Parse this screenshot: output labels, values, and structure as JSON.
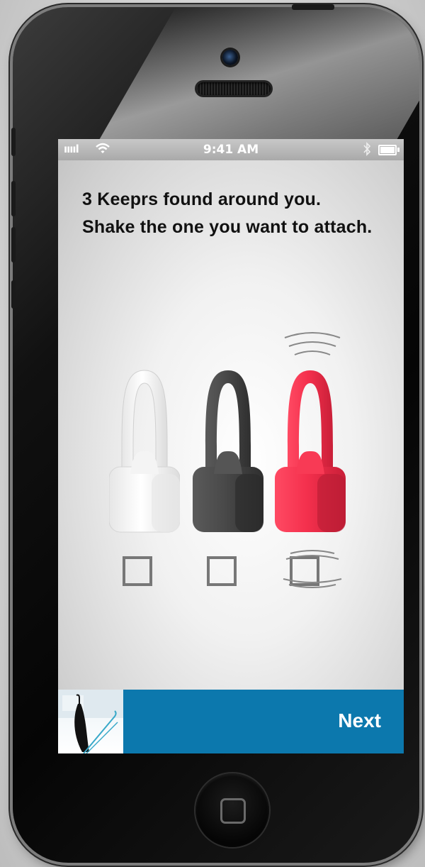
{
  "status_bar": {
    "carrier": "ııııl",
    "wifi_icon": "wifi-icon",
    "time": "9:41 AM",
    "bluetooth_icon": "bluetooth-icon",
    "battery_icon": "battery-icon"
  },
  "heading": {
    "line1": "3 Keeprs found around you.",
    "line2": "Shake the one you want to attach."
  },
  "keepers": [
    {
      "color": "#ffffff",
      "name": "white",
      "shaking": false,
      "selected": false
    },
    {
      "color": "#4a4a4a",
      "name": "black",
      "shaking": false,
      "selected": false
    },
    {
      "color": "#f0324e",
      "name": "red",
      "shaking": true,
      "selected": false
    }
  ],
  "footer": {
    "thumbnail": "umbrella-image",
    "next_label": "Next",
    "accent": "#0c78ad"
  }
}
